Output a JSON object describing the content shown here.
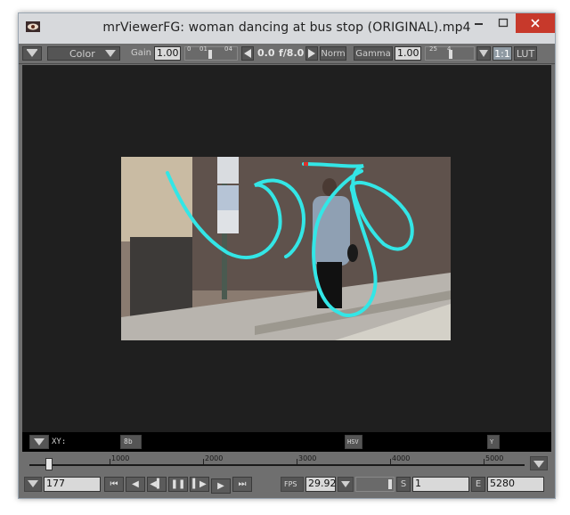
{
  "window": {
    "title": "mrViewerFG: woman dancing at bus stop (ORIGINAL).mp4",
    "minimize_glyph": "–",
    "maximize_glyph": "□",
    "close_glyph": "✕"
  },
  "toolbar": {
    "channel_value": "Color",
    "gain_label": "Gain",
    "gain_value": "1.00",
    "gain_ticks": [
      "0",
      "01",
      "04"
    ],
    "fstop_value": "0.0",
    "fstop_label": "f/8.0",
    "norm_label": "Norm",
    "gamma_label": "Gamma",
    "gamma_value": "1.00",
    "gamma_ticks": [
      "25",
      "4"
    ],
    "zoom_label": "1:1",
    "lut_label": "LUT"
  },
  "pixel_bar": {
    "xy_label": "XY:",
    "rgb_mode": "8b",
    "hsv_mode": "HSV",
    "lum_mode": "Y"
  },
  "timeline": {
    "tick_labels": [
      "1000",
      "2000",
      "3000",
      "4000",
      "5000"
    ]
  },
  "controls": {
    "current_frame": "177",
    "fps_label": "FPS",
    "fps_value": "29.92",
    "start_label": "S",
    "start_frame": "1",
    "end_label": "E",
    "end_frame": "5280"
  },
  "colors": {
    "stroke": "#33e6e6",
    "close_red": "#c7392b",
    "panel": "#6f6f6f",
    "viewer_bg": "#1f1f1f"
  }
}
